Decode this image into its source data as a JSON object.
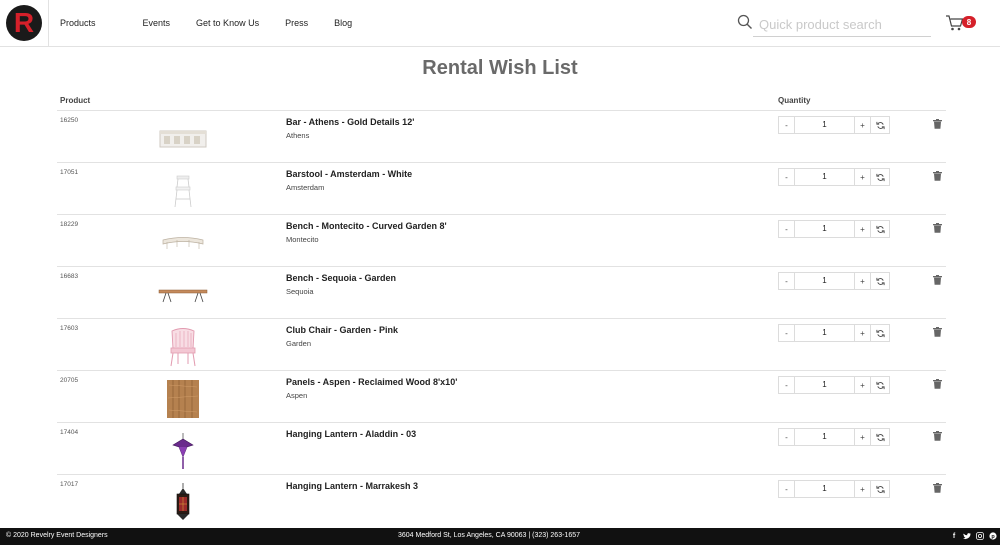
{
  "brand": {
    "logo_letter": "R",
    "accent": "#d5202a"
  },
  "nav": {
    "items": [
      {
        "label": "Products"
      },
      {
        "label": "Events"
      },
      {
        "label": "Get to Know Us"
      },
      {
        "label": "Press"
      },
      {
        "label": "Blog"
      }
    ]
  },
  "search": {
    "placeholder": "Quick product search",
    "value": ""
  },
  "cart": {
    "count": "8"
  },
  "page": {
    "title": "Rental Wish List"
  },
  "table": {
    "col_product": "Product",
    "col_quantity": "Quantity",
    "rows": [
      {
        "sku": "16250",
        "name": "Bar - Athens - Gold Details 12'",
        "category": "Athens",
        "qty": "1",
        "image": "bar-image"
      },
      {
        "sku": "17051",
        "name": "Barstool - Amsterdam - White",
        "category": "Amsterdam",
        "qty": "1",
        "image": "barstool-image"
      },
      {
        "sku": "18229",
        "name": "Bench - Montecito - Curved Garden 8'",
        "category": "Montecito",
        "qty": "1",
        "image": "curved-bench-image"
      },
      {
        "sku": "16683",
        "name": "Bench - Sequoia - Garden",
        "category": "Sequoia",
        "qty": "1",
        "image": "bench-image"
      },
      {
        "sku": "17603",
        "name": "Club Chair - Garden - Pink",
        "category": "Garden",
        "qty": "1",
        "image": "pink-chair-image"
      },
      {
        "sku": "20705",
        "name": "Panels - Aspen - Reclaimed Wood 8'x10'",
        "category": "Aspen",
        "qty": "1",
        "image": "wood-panel-image"
      },
      {
        "sku": "17404",
        "name": "Hanging Lantern - Aladdin - 03",
        "category": "",
        "qty": "1",
        "image": "purple-lantern-image"
      },
      {
        "sku": "17017",
        "name": "Hanging Lantern - Marrakesh 3",
        "category": "",
        "qty": "1",
        "image": "marrakesh-lantern-image"
      }
    ],
    "minus_label": "-",
    "plus_label": "+"
  },
  "footer": {
    "copyright": "© 2020 Revelry Event Designers",
    "address": "3604 Medford St, Los Angeles, CA 90063 | (323) 263-1657",
    "social": [
      "facebook-icon",
      "twitter-icon",
      "instagram-icon",
      "pinterest-icon"
    ]
  }
}
